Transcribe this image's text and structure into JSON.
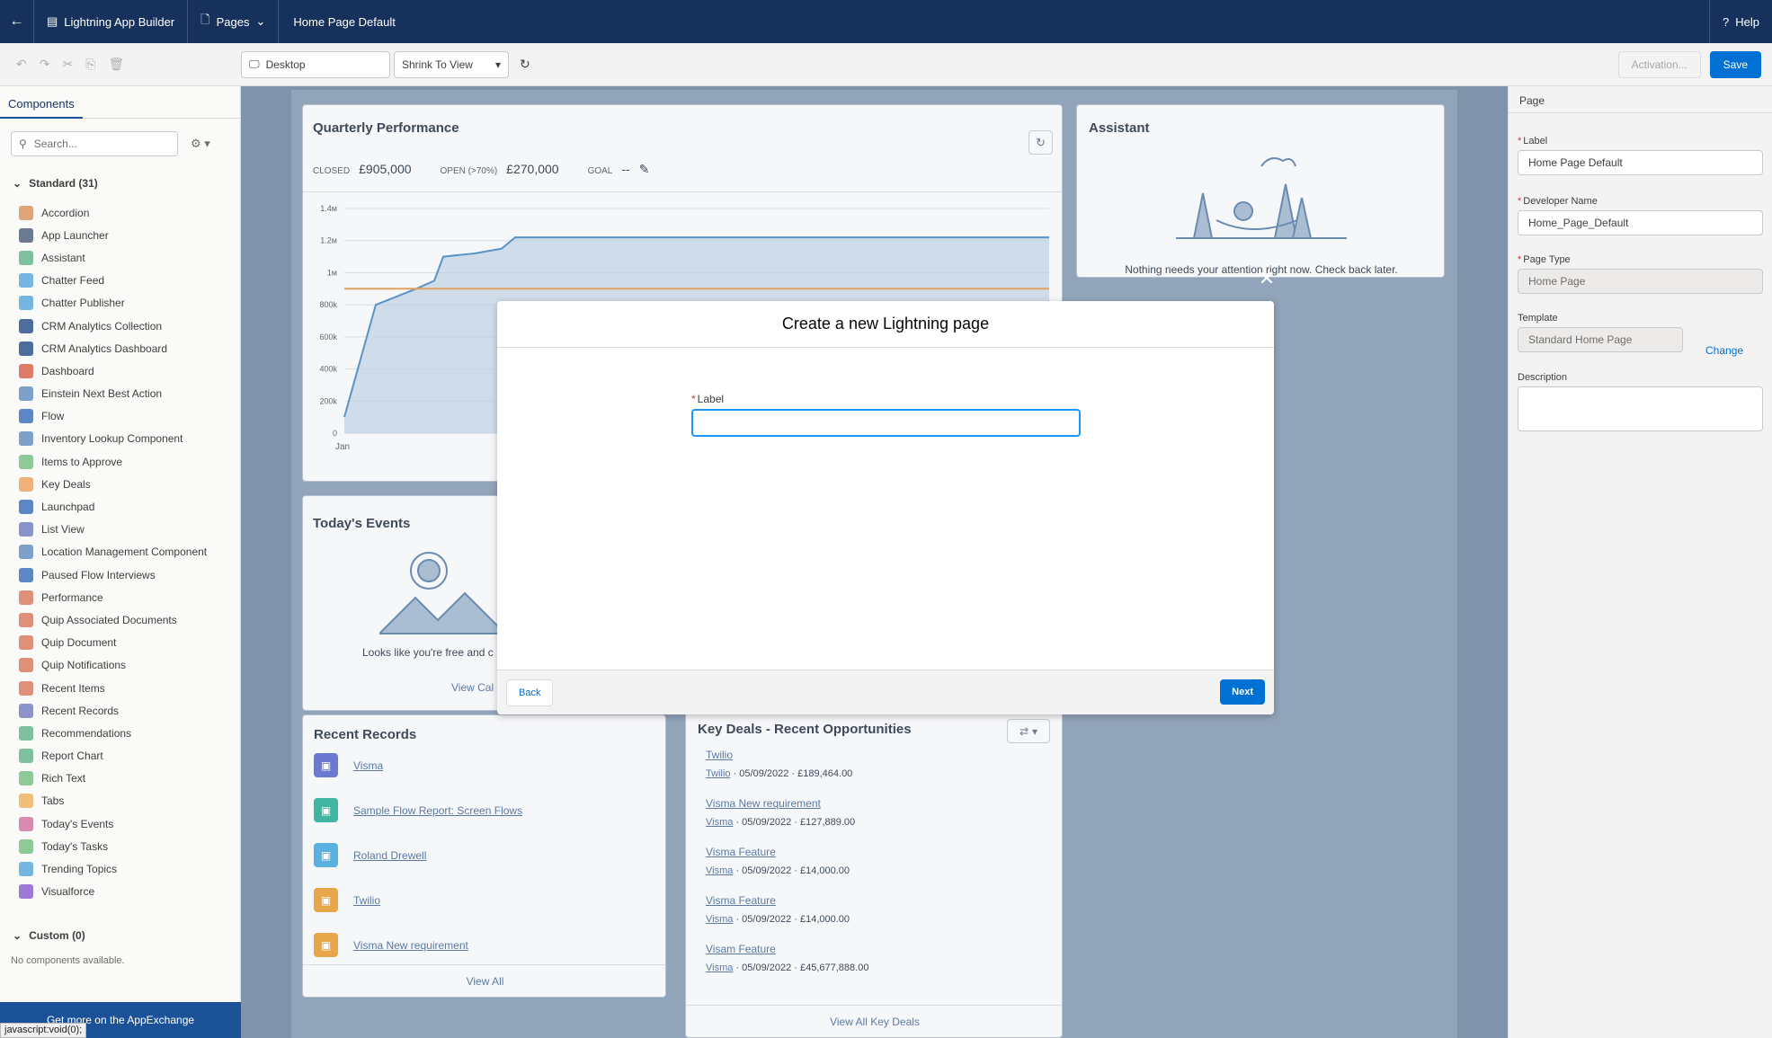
{
  "header": {
    "app_title": "Lightning App Builder",
    "pages_label": "Pages",
    "page_name": "Home Page Default",
    "help_label": "Help"
  },
  "toolbar": {
    "device": "Desktop",
    "zoom": "Shrink To View",
    "activation_label": "Activation...",
    "save_label": "Save"
  },
  "components_panel": {
    "tab_label": "Components",
    "search_placeholder": "Search...",
    "standard_label": "Standard (31)",
    "items": [
      {
        "label": "Accordion",
        "color": "#e0a47a"
      },
      {
        "label": "App Launcher",
        "color": "#6b7a8c"
      },
      {
        "label": "Assistant",
        "color": "#7fc0a0"
      },
      {
        "label": "Chatter Feed",
        "color": "#74b6e0"
      },
      {
        "label": "Chatter Publisher",
        "color": "#74b6e0"
      },
      {
        "label": "CRM Analytics Collection",
        "color": "#4f6d9c"
      },
      {
        "label": "CRM Analytics Dashboard",
        "color": "#4f6d9c"
      },
      {
        "label": "Dashboard",
        "color": "#e07a6a"
      },
      {
        "label": "Einstein Next Best Action",
        "color": "#7fa0c8"
      },
      {
        "label": "Flow",
        "color": "#5d86c4"
      },
      {
        "label": "Inventory Lookup Component",
        "color": "#7fa0c8"
      },
      {
        "label": "Items to Approve",
        "color": "#8ec99a"
      },
      {
        "label": "Key Deals",
        "color": "#f0b27a"
      },
      {
        "label": "Launchpad",
        "color": "#5d86c4"
      },
      {
        "label": "List View",
        "color": "#8b93c8"
      },
      {
        "label": "Location Management Component",
        "color": "#7fa0c8"
      },
      {
        "label": "Paused Flow Interviews",
        "color": "#5d86c4"
      },
      {
        "label": "Performance",
        "color": "#e0907a"
      },
      {
        "label": "Quip Associated Documents",
        "color": "#e0907a"
      },
      {
        "label": "Quip Document",
        "color": "#e0907a"
      },
      {
        "label": "Quip Notifications",
        "color": "#e0907a"
      },
      {
        "label": "Recent Items",
        "color": "#e0907a"
      },
      {
        "label": "Recent Records",
        "color": "#8b93c8"
      },
      {
        "label": "Recommendations",
        "color": "#7fc0a0"
      },
      {
        "label": "Report Chart",
        "color": "#7fc0a0"
      },
      {
        "label": "Rich Text",
        "color": "#8ec99a"
      },
      {
        "label": "Tabs",
        "color": "#f0c07a"
      },
      {
        "label": "Today's Events",
        "color": "#d88ab0"
      },
      {
        "label": "Today's Tasks",
        "color": "#8ec99a"
      },
      {
        "label": "Trending Topics",
        "color": "#74b6e0"
      },
      {
        "label": "Visualforce",
        "color": "#9b7ad8"
      }
    ],
    "custom_label": "Custom (0)",
    "no_components": "No components available.",
    "appexchange": "Get more on the AppExchange",
    "status_url": "javascript:void(0);"
  },
  "properties": {
    "heading": "Page",
    "label_label": "Label",
    "label_value": "Home Page Default",
    "dev_name_label": "Developer Name",
    "dev_name_value": "Home_Page_Default",
    "page_type_label": "Page Type",
    "page_type_value": "Home Page",
    "template_label": "Template",
    "template_value": "Standard Home Page",
    "change_label": "Change",
    "description_label": "Description"
  },
  "canvas": {
    "quarterly": {
      "title": "Quarterly Performance",
      "closed_label": "CLOSED",
      "closed_value": "£905,000",
      "open_label": "OPEN (>70%)",
      "open_value": "£270,000",
      "goal_label": "GOAL",
      "goal_value": "--"
    },
    "assistant": {
      "title": "Assistant",
      "message": "Nothing needs your attention right now. Check back later."
    },
    "events": {
      "title": "Today's Events",
      "message": "Looks like you're free and c",
      "view_calendar": "View Cal"
    },
    "recent_records": {
      "title": "Recent Records",
      "items": [
        {
          "name": "Visma",
          "color": "#6b7ad0"
        },
        {
          "name": "Sample Flow Report: Screen Flows",
          "color": "#3fb6a0"
        },
        {
          "name": "Roland Drewell",
          "color": "#5ab0e0"
        },
        {
          "name": "Twilio",
          "color": "#e8a64a"
        },
        {
          "name": "Visma New requirement",
          "color": "#e8a64a"
        }
      ],
      "view_all": "View All"
    },
    "key_deals": {
      "title": "Key Deals - Recent Opportunities",
      "items": [
        {
          "name": "Twilio",
          "account": "Twilio",
          "meta": "· 05/09/2022 · £189,464.00"
        },
        {
          "name": "Visma New requirement",
          "account": "Visma",
          "meta": "· 05/09/2022 · £127,889.00"
        },
        {
          "name": "Visma Feature",
          "account": "Visma",
          "meta": "· 05/09/2022 · £14,000.00"
        },
        {
          "name": "Visma Feature",
          "account": "Visma",
          "meta": "· 05/09/2022 · £14,000.00"
        },
        {
          "name": "Visam Feature",
          "account": "Visma",
          "meta": "· 05/09/2022 · £45,677,888.00"
        }
      ],
      "view_all": "View All Key Deals"
    }
  },
  "chart_data": {
    "type": "line",
    "title": "",
    "x": [
      "Jan"
    ],
    "yticks": [
      "1.4м",
      "1.2м",
      "1м",
      "800k",
      "600k",
      "400k",
      "200k",
      "0"
    ],
    "ylim": [
      0,
      1400000
    ],
    "series": [
      {
        "color": "#5a93c8",
        "values": [
          100000,
          800000,
          900000,
          950000,
          1100000,
          1120000,
          1150000,
          1220000,
          1220000
        ]
      }
    ],
    "goal_line": 900000,
    "goal_color": "#e0a060"
  },
  "modal": {
    "title": "Create a new Lightning page",
    "label_field": "Label",
    "label_value": "",
    "back_label": "Back",
    "next_label": "Next"
  }
}
